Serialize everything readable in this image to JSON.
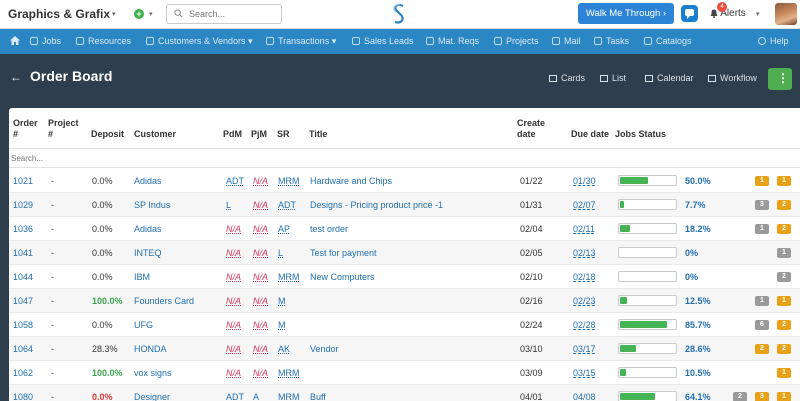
{
  "topbar": {
    "brand": "Graphics & Grafix",
    "search_placeholder": "Search...",
    "walk_label": "Walk Me Through ›",
    "alerts_label": "Alerts",
    "alerts_count": "4"
  },
  "nav": [
    {
      "label": "Jobs",
      "icon": "briefcase-icon"
    },
    {
      "label": "Resources",
      "icon": "folder-icon"
    },
    {
      "label": "Customers & Vendors ▾",
      "icon": "briefcase-icon"
    },
    {
      "label": "Transactions ▾",
      "icon": "card-icon"
    },
    {
      "label": "Sales Leads",
      "icon": "flag-icon"
    },
    {
      "label": "Mat. Reqs",
      "icon": "list-icon"
    },
    {
      "label": "Projects",
      "icon": "folder-icon"
    },
    {
      "label": "Mail",
      "icon": "refresh-icon"
    },
    {
      "label": "Tasks",
      "icon": "check-icon"
    },
    {
      "label": "Catalogs",
      "icon": "grid-icon"
    },
    {
      "label": "Help",
      "icon": "help-icon"
    }
  ],
  "header": {
    "title": "Order Board",
    "views": [
      "Cards",
      "List",
      "Calendar",
      "Workflow"
    ]
  },
  "table": {
    "columns": {
      "order": "Order",
      "order2": "#",
      "project": "Project",
      "project2": "#",
      "deposit": "Deposit",
      "customer": "Customer",
      "pdm": "PdM",
      "pjm": "PjM",
      "sr": "SR",
      "title": "Title",
      "create": "Create",
      "create2": "date",
      "due": "Due date",
      "jobs": "Jobs Status"
    },
    "search_placeholder": "Search...",
    "rows": [
      {
        "order": "1021",
        "project": "-",
        "deposit": "0.0%",
        "dep_style": "",
        "customer": "Adidas",
        "pdm": "ADT",
        "pjm": "N/A",
        "sr": "MRM",
        "title": "Hardware and Chips",
        "create": "01/22",
        "due": "01/30",
        "progress": 0.5,
        "pct": "50.0%",
        "badges": [
          {
            "t": "1",
            "c": "orange"
          },
          {
            "t": "1",
            "c": "orange"
          }
        ]
      },
      {
        "order": "1029",
        "project": "-",
        "deposit": "0.0%",
        "dep_style": "",
        "customer": "SP Indus",
        "pdm": "L",
        "pjm": "N/A",
        "sr": "ADT",
        "title": "Designs - Pricing product price -1",
        "create": "01/31",
        "due": "02/07",
        "progress": 0.077,
        "pct": "7.7%",
        "badges": [
          {
            "t": "3",
            "c": "gray"
          },
          {
            "t": "2",
            "c": "orange"
          }
        ]
      },
      {
        "order": "1036",
        "project": "-",
        "deposit": "0.0%",
        "dep_style": "",
        "customer": "Adidas",
        "pdm": "N/A",
        "pjm": "N/A",
        "sr": "AP",
        "title": "test order",
        "create": "02/04",
        "due": "02/11",
        "progress": 0.182,
        "pct": "18.2%",
        "badges": [
          {
            "t": "1",
            "c": "gray"
          },
          {
            "t": "2",
            "c": "orange"
          }
        ]
      },
      {
        "order": "1041",
        "project": "-",
        "deposit": "0.0%",
        "dep_style": "",
        "customer": "INTEQ",
        "pdm": "N/A",
        "pjm": "N/A",
        "sr": "L",
        "title": "Test for payment",
        "create": "02/05",
        "due": "02/13",
        "progress": 0,
        "pct": "0%",
        "badges": [
          {
            "t": "1",
            "c": "gray"
          }
        ]
      },
      {
        "order": "1044",
        "project": "-",
        "deposit": "0.0%",
        "dep_style": "",
        "customer": "IBM",
        "pdm": "N/A",
        "pjm": "N/A",
        "sr": "MRM",
        "title": "New Computers",
        "create": "02/10",
        "due": "02/18",
        "progress": 0,
        "pct": "0%",
        "badges": [
          {
            "t": "2",
            "c": "gray"
          }
        ]
      },
      {
        "order": "1047",
        "project": "-",
        "deposit": "100.0%",
        "dep_style": "green",
        "customer": "Founders Card",
        "pdm": "N/A",
        "pjm": "N/A",
        "sr": "M",
        "title": "",
        "create": "02/16",
        "due": "02/23",
        "progress": 0.125,
        "pct": "12.5%",
        "badges": [
          {
            "t": "1",
            "c": "gray"
          },
          {
            "t": "1",
            "c": "orange"
          }
        ]
      },
      {
        "order": "1058",
        "project": "-",
        "deposit": "0.0%",
        "dep_style": "",
        "customer": "UFG",
        "pdm": "N/A",
        "pjm": "N/A",
        "sr": "M",
        "title": "",
        "create": "02/24",
        "due": "02/28",
        "progress": 0.857,
        "pct": "85.7%",
        "badges": [
          {
            "t": "6",
            "c": "gray"
          },
          {
            "t": "2",
            "c": "orange"
          }
        ]
      },
      {
        "order": "1064",
        "project": "-",
        "deposit": "28.3%",
        "dep_style": "",
        "customer": "HONDA",
        "pdm": "N/A",
        "pjm": "N/A",
        "sr": "AK",
        "title": "Vendor",
        "create": "03/10",
        "due": "03/17",
        "progress": 0.286,
        "pct": "28.6%",
        "badges": [
          {
            "t": "2",
            "c": "orange"
          },
          {
            "t": "2",
            "c": "orange"
          }
        ]
      },
      {
        "order": "1062",
        "project": "-",
        "deposit": "100.0%",
        "dep_style": "green",
        "customer": "vox signs",
        "pdm": "N/A",
        "pjm": "N/A",
        "sr": "MRM",
        "title": "",
        "create": "03/09",
        "due": "03/15",
        "progress": 0.105,
        "pct": "10.5%",
        "badges": [
          {
            "t": "1",
            "c": "orange"
          }
        ]
      },
      {
        "order": "1080",
        "project": "-",
        "deposit": "0.0%",
        "dep_style": "red",
        "customer": "Designer",
        "pdm": "ADT",
        "pjm": "A",
        "sr": "MRM",
        "title": "Buff",
        "create": "04/01",
        "due": "04/08",
        "progress": 0.641,
        "pct": "64.1%",
        "badges": [
          {
            "t": "2",
            "c": "gray"
          },
          {
            "t": "3",
            "c": "orange"
          },
          {
            "t": "1",
            "c": "orange"
          }
        ]
      }
    ]
  }
}
